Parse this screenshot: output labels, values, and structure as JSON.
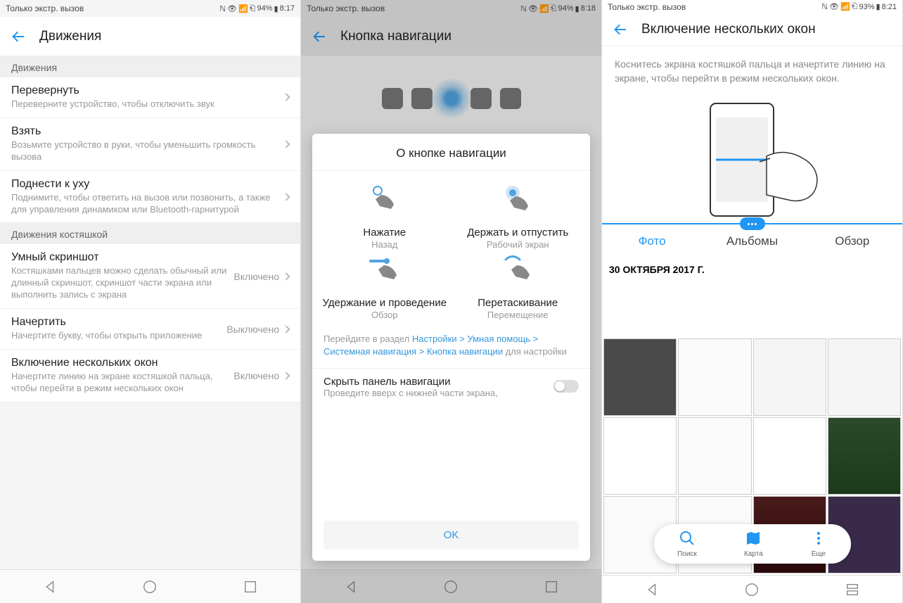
{
  "screens": [
    {
      "status": {
        "carrier": "Только экстр. вызов",
        "battery": "94%",
        "time": "8:17"
      },
      "title": "Движения",
      "sections": [
        {
          "header": "Движения",
          "items": [
            {
              "title": "Перевернуть",
              "sub": "Переверните устройство, чтобы отключить звук",
              "value": ""
            },
            {
              "title": "Взять",
              "sub": "Возьмите устройство в руки, чтобы уменьшить громкость вызова",
              "value": ""
            },
            {
              "title": "Поднести к уху",
              "sub": "Поднимите, чтобы ответить на вызов или позвонить, а также для управления динамиком или Bluetooth-гарнитурой",
              "value": ""
            }
          ]
        },
        {
          "header": "Движения костяшкой",
          "items": [
            {
              "title": "Умный скриншот",
              "sub": "Костяшками пальцев можно сделать обычный или длинный скриншот, скриншот части экрана или выполнить запись с экрана",
              "value": "Включено"
            },
            {
              "title": "Начертить",
              "sub": "Начертите букву, чтобы открыть приложение",
              "value": "Выключено"
            },
            {
              "title": "Включение нескольких окон",
              "sub": "Начертите линию на экране костяшкой пальца, чтобы перейти в режим нескольких окон",
              "value": "Включено"
            }
          ]
        }
      ]
    },
    {
      "status": {
        "carrier": "Только экстр. вызов",
        "battery": "94%",
        "time": "8:18"
      },
      "title": "Кнопка навигации",
      "modal": {
        "title": "О кнопке навигации",
        "gestures": [
          {
            "title": "Нажатие",
            "sub": "Назад"
          },
          {
            "title": "Держать и отпустить",
            "sub": "Рабочий экран"
          },
          {
            "title": "Удержание и проведение",
            "sub": "Обзор"
          },
          {
            "title": "Перетаскивание",
            "sub": "Перемещение"
          }
        ],
        "hint_prefix": "Перейдите в раздел ",
        "hint_link": "Настройки > Умная помощь > Системная навигация > Кнопка навигации",
        "hint_suffix": " для настройки",
        "toggle_title": "Скрыть панель навигации",
        "toggle_sub": "Проведите вверх с нижней части экрана,",
        "ok": "OK"
      }
    },
    {
      "status": {
        "carrier": "Только экстр. вызов",
        "battery": "93%",
        "time": "8:21"
      },
      "title": "Включение нескольких окон",
      "desc": "Коснитесь экрана костяшкой пальца и начертите линию на экране, чтобы перейти в режим нескольких окон.",
      "tabs": [
        "Фото",
        "Альбомы",
        "Обзор"
      ],
      "active_tab": 0,
      "gallery_date": "30 ОКТЯБРЯ 2017 Г.",
      "fab": [
        {
          "label": "Поиск"
        },
        {
          "label": "Карта"
        },
        {
          "label": "Еще"
        }
      ]
    }
  ]
}
